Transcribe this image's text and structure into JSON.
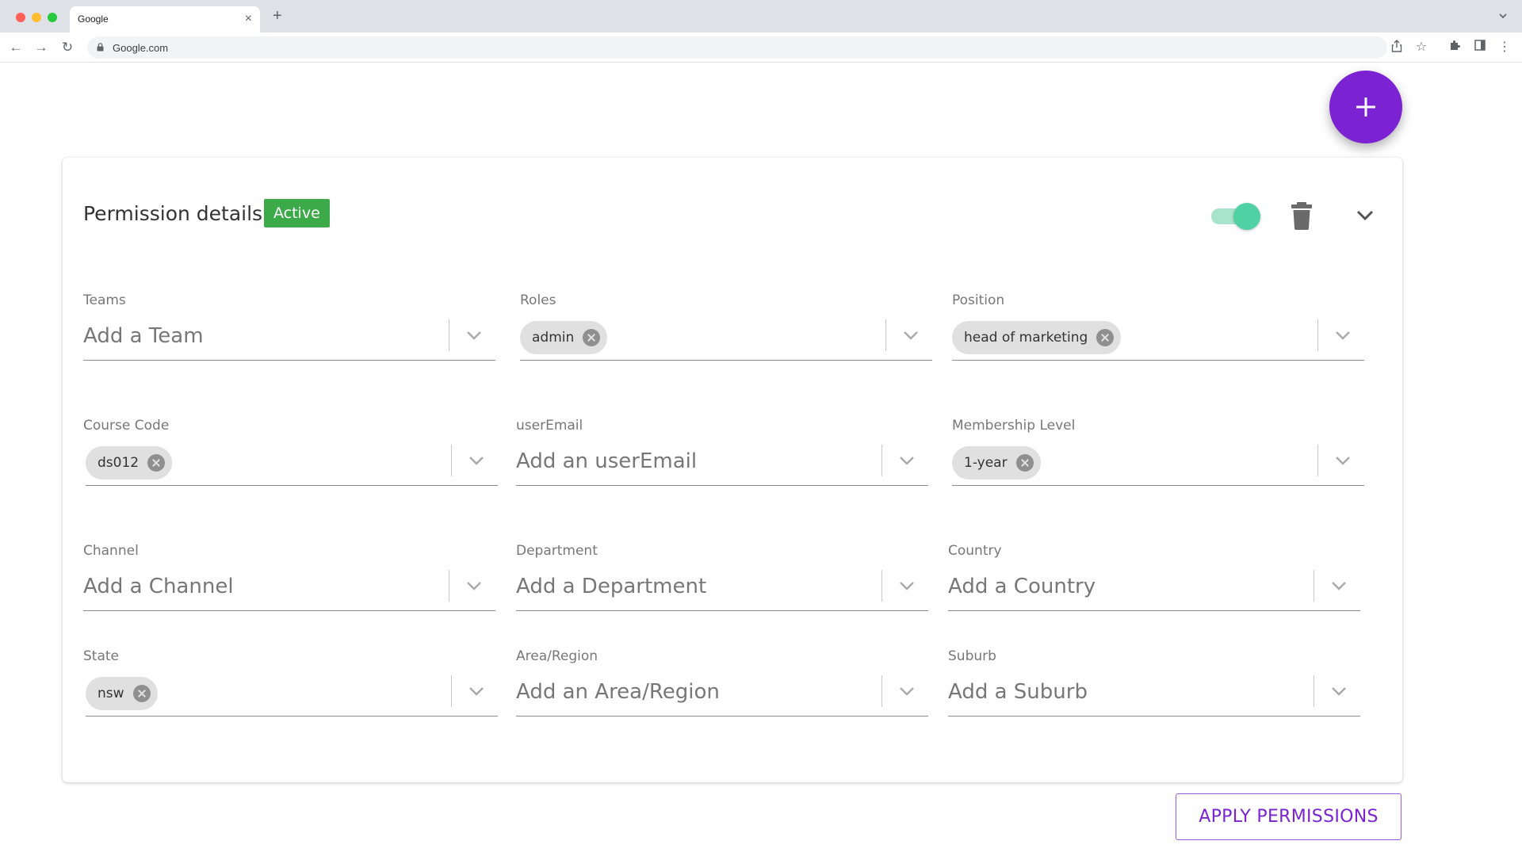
{
  "browser": {
    "tab_title": "Google",
    "url": "Google.com"
  },
  "colors": {
    "accent": "#7b22d3",
    "active_badge": "#3daa4a",
    "toggle_on": "#4fd1a5"
  },
  "card": {
    "title": "Permission details",
    "status": "Active",
    "toggle_on": true
  },
  "fields": {
    "teams": {
      "label": "Teams",
      "placeholder": "Add a Team"
    },
    "roles": {
      "label": "Roles",
      "chip": "admin"
    },
    "position": {
      "label": "Position",
      "chip": "head of marketing"
    },
    "course_code": {
      "label": "Course Code",
      "chip": "ds012"
    },
    "user_email": {
      "label": "userEmail",
      "placeholder": "Add an userEmail"
    },
    "membership_level": {
      "label": "Membership Level",
      "chip": "1-year"
    },
    "channel": {
      "label": "Channel",
      "placeholder": "Add a Channel"
    },
    "department": {
      "label": "Department",
      "placeholder": "Add a Department"
    },
    "country": {
      "label": "Country",
      "placeholder": "Add a Country"
    },
    "state": {
      "label": "State",
      "chip": "nsw"
    },
    "area_region": {
      "label": "Area/Region",
      "placeholder": "Add an Area/Region"
    },
    "suburb": {
      "label": "Suburb",
      "placeholder": "Add a Suburb"
    }
  },
  "apply_label": "APPLY PERMISSIONS"
}
